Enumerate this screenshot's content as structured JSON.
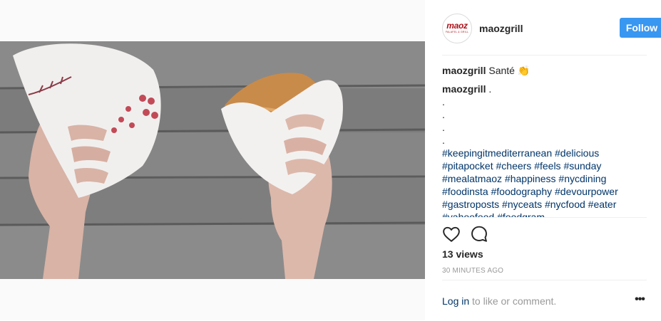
{
  "header": {
    "username": "maozgrill",
    "follow_label": "Follow",
    "avatar_logo_text": "maoz",
    "avatar_logo_sub": "FALAFEL & GRILL"
  },
  "caption": {
    "username": "maozgrill",
    "text": "Santé 👏"
  },
  "comment": {
    "username": "maozgrill",
    "text": ".",
    "dot_lines": [
      ".",
      ".",
      ".",
      "."
    ],
    "hashtag_lines": [
      "#keepingitmediterranean #delicious",
      "#pitapocket #cheers #feels #sunday",
      "#mealatmaoz #happiness #nycdining",
      "#foodinsta #foodography #devourpower",
      "#gastroposts #nyceats #nycfood #eater",
      "#yahoofood #foodgram"
    ]
  },
  "stats": {
    "views": "13 views",
    "timestamp": "30 MINUTES AGO"
  },
  "footer": {
    "login_link": "Log in",
    "login_rest": " to like or comment.",
    "more_label": "•••"
  },
  "colors": {
    "follow_bg": "#3897f0",
    "link": "#003569",
    "muted": "#999999",
    "brand_red": "#b0121b"
  },
  "icons": [
    "heart-icon",
    "comment-icon",
    "more-options-icon"
  ]
}
